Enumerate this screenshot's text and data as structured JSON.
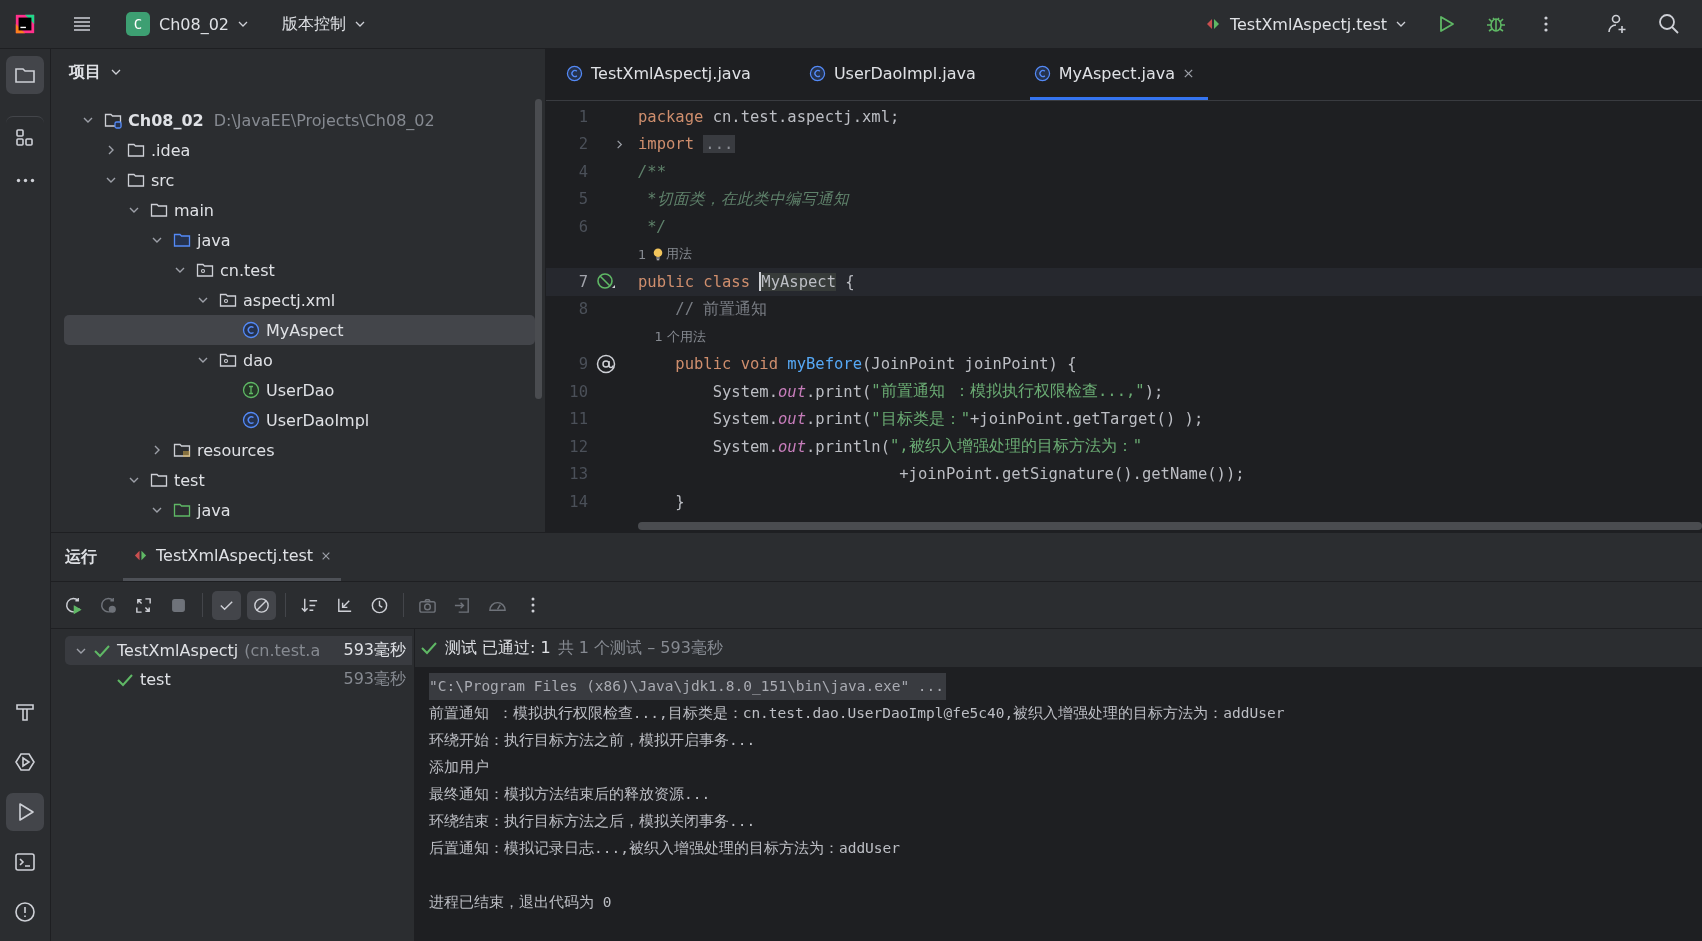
{
  "title_bar": {
    "project_badge": "C",
    "project": "Ch08_02",
    "vcs": "版本控制",
    "run_config": "TestXmlAspectj.test"
  },
  "tool_strip": {
    "top": [
      {
        "kind": "project",
        "selected": true
      },
      {
        "kind": "structure",
        "selected": false
      },
      {
        "kind": "more",
        "selected": false
      }
    ],
    "bottom": [
      {
        "kind": "build",
        "selected": false
      },
      {
        "kind": "services",
        "selected": false
      },
      {
        "kind": "run",
        "selected": true
      },
      {
        "kind": "terminal",
        "selected": false
      },
      {
        "kind": "problems",
        "selected": false
      }
    ]
  },
  "project_panel": {
    "title": "项目",
    "tree": [
      {
        "label": "Ch08_02",
        "path": "D:\\JavaEE\\Projects\\Ch08_02",
        "kind": "module",
        "expanded": true,
        "selected": false,
        "children": [
          {
            "label": ".idea",
            "kind": "folder",
            "expanded": false,
            "selected": false
          },
          {
            "label": "src",
            "kind": "folder",
            "expanded": true,
            "selected": false,
            "children": [
              {
                "label": "main",
                "kind": "folder",
                "expanded": true,
                "selected": false,
                "children": [
                  {
                    "label": "java",
                    "kind": "source",
                    "expanded": true,
                    "selected": false,
                    "children": [
                      {
                        "label": "cn.test",
                        "kind": "package",
                        "expanded": true,
                        "selected": false,
                        "children": [
                          {
                            "label": "aspectj.xml",
                            "kind": "package",
                            "expanded": true,
                            "selected": false,
                            "children": [
                              {
                                "label": "MyAspect",
                                "kind": "class",
                                "selected": true
                              }
                            ]
                          },
                          {
                            "label": "dao",
                            "kind": "package",
                            "expanded": true,
                            "selected": false,
                            "children": [
                              {
                                "label": "UserDao",
                                "kind": "interface",
                                "selected": false
                              },
                              {
                                "label": "UserDaoImpl",
                                "kind": "class",
                                "selected": false
                              }
                            ]
                          }
                        ]
                      }
                    ]
                  },
                  {
                    "label": "resources",
                    "kind": "resources",
                    "expanded": false,
                    "selected": false
                  }
                ]
              },
              {
                "label": "test",
                "kind": "folder",
                "expanded": true,
                "selected": false,
                "children": [
                  {
                    "label": "java",
                    "kind": "test-source",
                    "expanded": true,
                    "selected": false
                  }
                ]
              }
            ]
          }
        ]
      }
    ]
  },
  "editor": {
    "tabs": [
      {
        "label": "TestXmlAspectj.java",
        "selected": false
      },
      {
        "label": "UserDaoImpl.java",
        "selected": false
      },
      {
        "label": "MyAspect.java",
        "selected": true
      }
    ],
    "lines": [
      {
        "num": "1",
        "tokens": [
          {
            "kind": "kw",
            "text": "package"
          },
          {
            "kind": "plain",
            "text": " cn.test.aspectj.xml;"
          }
        ]
      },
      {
        "num": "2",
        "gutter": {
          "kind": "fold"
        },
        "tokens": [
          {
            "kind": "kw",
            "text": "import "
          },
          {
            "kind": "folded",
            "text": "..."
          }
        ]
      },
      {
        "num": "4",
        "tokens": [
          {
            "kind": "doc",
            "text": "/**"
          }
        ]
      },
      {
        "num": "5",
        "tokens": [
          {
            "kind": "doc",
            "text": " *切面类，在此类中编写通知"
          }
        ]
      },
      {
        "num": "6",
        "tokens": [
          {
            "kind": "doc",
            "text": " */"
          }
        ]
      },
      {
        "tokens": [
          {
            "kind": "hint",
            "text": "1 "
          },
          {
            "kind": "bulb"
          },
          {
            "kind": "hint",
            "text": "用法"
          }
        ]
      },
      {
        "num": "7",
        "current": true,
        "gutter": {
          "kind": "aspect"
        },
        "tokens": [
          {
            "kind": "kw",
            "text": "public class "
          },
          {
            "kind": "caret"
          },
          {
            "kind": "ident",
            "text": "MyAspect"
          },
          {
            "kind": "plain",
            "text": " {"
          }
        ]
      },
      {
        "num": "8",
        "tokens": [
          {
            "kind": "comment",
            "text": "    // 前置通知"
          }
        ]
      },
      {
        "tokens": [
          {
            "kind": "hint",
            "text": "    1 个用法"
          }
        ]
      },
      {
        "num": "9",
        "gutter": {
          "kind": "advice"
        },
        "tokens": [
          {
            "kind": "kw",
            "text": "    public void "
          },
          {
            "kind": "method",
            "text": "myBefore"
          },
          {
            "kind": "plain",
            "text": "(JoinPoint joinPoint) {"
          }
        ]
      },
      {
        "num": "10",
        "tokens": [
          {
            "kind": "plain",
            "text": "        System."
          },
          {
            "kind": "field",
            "text": "out"
          },
          {
            "kind": "plain",
            "text": ".print("
          },
          {
            "kind": "str",
            "text": "\"前置通知 ：模拟执行权限检查...,\""
          },
          {
            "kind": "plain",
            "text": ");"
          }
        ]
      },
      {
        "num": "11",
        "tokens": [
          {
            "kind": "plain",
            "text": "        System."
          },
          {
            "kind": "field",
            "text": "out"
          },
          {
            "kind": "plain",
            "text": ".print("
          },
          {
            "kind": "str",
            "text": "\"目标类是：\""
          },
          {
            "kind": "plain",
            "text": "+joinPoint.getTarget() );"
          }
        ]
      },
      {
        "num": "12",
        "tokens": [
          {
            "kind": "plain",
            "text": "        System."
          },
          {
            "kind": "field",
            "text": "out"
          },
          {
            "kind": "plain",
            "text": ".println("
          },
          {
            "kind": "str",
            "text": "\",被织入增强处理的目标方法为：\""
          }
        ]
      },
      {
        "num": "13",
        "tokens": [
          {
            "kind": "plain",
            "text": "                            +joinPoint.getSignature().getName());"
          }
        ]
      },
      {
        "num": "14",
        "tokens": [
          {
            "kind": "plain",
            "text": "    }"
          }
        ]
      }
    ]
  },
  "run_panel": {
    "title": "运行",
    "tabs": [
      {
        "label": "TestXmlAspectj.test",
        "selected": true
      }
    ],
    "toolbar_groups": [
      {
        "buttons": [
          {
            "kind": "rerun",
            "disabled": false,
            "on": false
          },
          {
            "kind": "rerun-failed",
            "disabled": true,
            "on": false
          },
          {
            "kind": "auto-rerun",
            "disabled": false,
            "on": false
          },
          {
            "kind": "stop",
            "disabled": true,
            "on": false
          }
        ]
      },
      {
        "buttons": [
          {
            "kind": "show-passed",
            "disabled": false,
            "on": true
          },
          {
            "kind": "show-ignored",
            "disabled": false,
            "on": true
          }
        ]
      },
      {
        "buttons": [
          {
            "kind": "sort",
            "disabled": false,
            "on": false
          },
          {
            "kind": "collapse",
            "disabled": false,
            "on": false
          },
          {
            "kind": "history",
            "disabled": false,
            "on": false
          }
        ]
      },
      {
        "buttons": [
          {
            "kind": "camera",
            "disabled": true,
            "on": false
          },
          {
            "kind": "import",
            "disabled": true,
            "on": false
          },
          {
            "kind": "gauge",
            "disabled": true,
            "on": false
          },
          {
            "kind": "more",
            "disabled": false,
            "on": false
          }
        ]
      }
    ],
    "tests": [
      {
        "name": "TestXmlAspectj",
        "detail": "(cn.test.a",
        "time": "593毫秒",
        "passed": true,
        "expanded": true,
        "selected": true,
        "children": [
          {
            "name": "test",
            "time": "593毫秒",
            "passed": true,
            "selected": false
          }
        ]
      }
    ],
    "status": {
      "passed": true,
      "label": "测试 已通过: 1",
      "summary": "共 1 个测试 – 593毫秒"
    },
    "console": [
      {
        "kind": "command",
        "text": "\"C:\\Program Files (x86)\\Java\\jdk1.8.0_151\\bin\\java.exe\" ..."
      },
      {
        "kind": "output",
        "text": "前置通知 ：模拟执行权限检查...,目标类是：cn.test.dao.UserDaoImpl@fe5c40,被织入增强处理的目标方法为：addUser"
      },
      {
        "kind": "output",
        "text": "环绕开始：执行目标方法之前，模拟开启事务..."
      },
      {
        "kind": "output",
        "text": "添加用户"
      },
      {
        "kind": "output",
        "text": "最终通知：模拟方法结束后的释放资源..."
      },
      {
        "kind": "output",
        "text": "环绕结束：执行目标方法之后，模拟关闭事务..."
      },
      {
        "kind": "output",
        "text": "后置通知：模拟记录日志...,被织入增强处理的目标方法为：addUser"
      },
      {
        "kind": "exit",
        "text": "进程已结束，退出代码为 0"
      }
    ]
  }
}
